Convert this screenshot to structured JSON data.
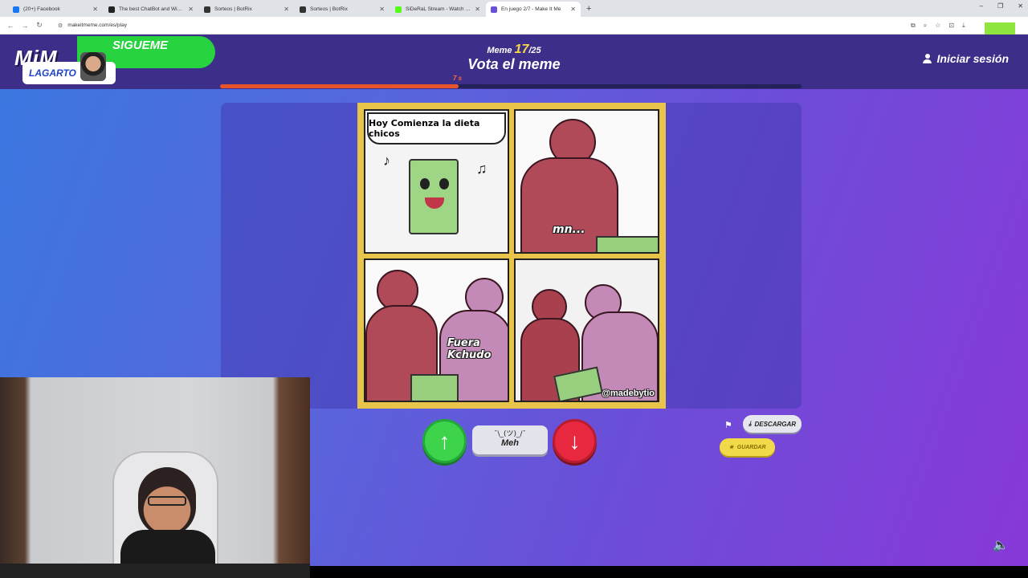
{
  "browser": {
    "tabs": [
      {
        "title": "(20+) Facebook",
        "color": "#1877f2",
        "active": false
      },
      {
        "title": "The best ChatBot and Widgets",
        "color": "#222222",
        "active": false
      },
      {
        "title": "Sorteos | BotRix",
        "color": "#333333",
        "active": false
      },
      {
        "title": "Sorteos | BotRix",
        "color": "#333333",
        "active": false
      },
      {
        "title": "SiDeRaL Stream - Watch Live o",
        "color": "#53fc18",
        "active": false
      },
      {
        "title": "En juego 2/7 - Make It Me",
        "color": "#6a4fd8",
        "active": true
      }
    ],
    "new_tab": "+",
    "window_controls": [
      "–",
      "❐",
      "✕"
    ],
    "url": "makeitmeme.com/es/play"
  },
  "header": {
    "logo": "MiM",
    "follow_banner": "SIGUEME",
    "streamer_name": "LAGARTO",
    "meme_label": "Meme",
    "meme_current": "17",
    "meme_total": "/25",
    "title": "Vota el meme",
    "login_label": "Iniciar sesión"
  },
  "timer": {
    "label": "7 s",
    "progress": 0.41,
    "color": "#e8542a"
  },
  "meme": {
    "panel1_text": "Hoy Comienza la dieta chicos",
    "panel2_text": "mn...",
    "panel3_text": "Fuera Kchudo",
    "watermark": "@madebytio"
  },
  "votes": {
    "up_icon": "arrow-up-icon",
    "meh_face": "¯\\_(ツ)_/¯",
    "meh_label": "Meh",
    "down_icon": "arrow-down-icon"
  },
  "actions": {
    "download_label": "DESCARGAR",
    "save_label": "GUARDAR"
  }
}
